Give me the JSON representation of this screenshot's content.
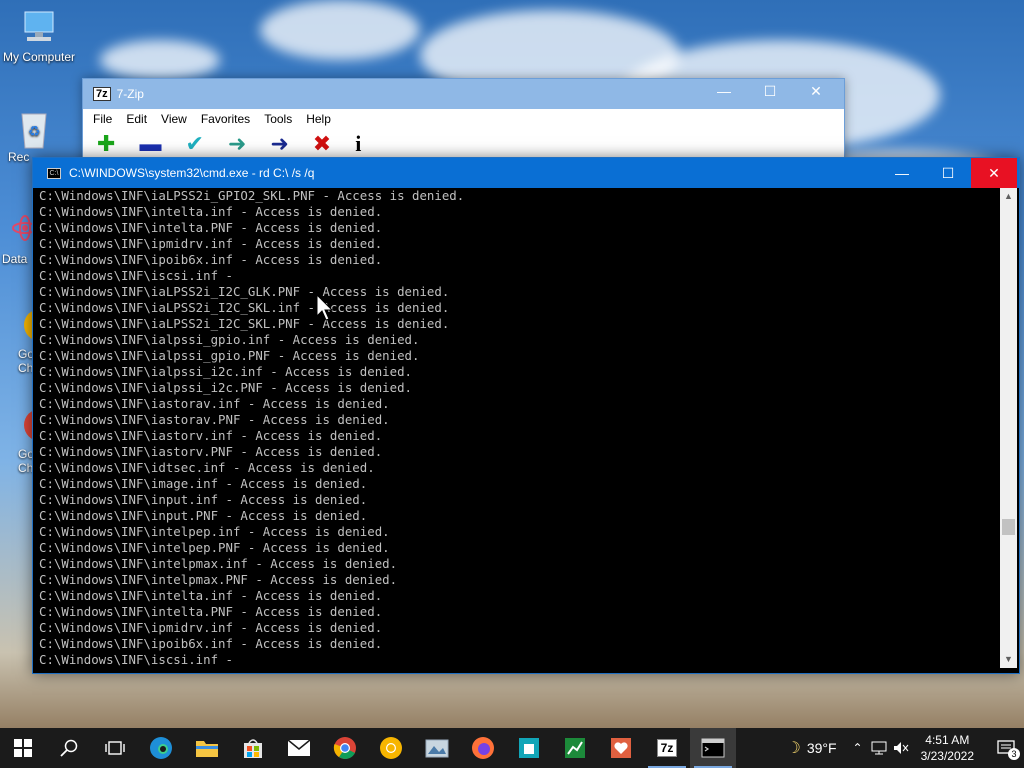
{
  "desktop": {
    "icons": [
      {
        "label": "My Computer"
      },
      {
        "label": "Rec"
      },
      {
        "label": "Data"
      },
      {
        "label": "Go Ch"
      },
      {
        "label": "Go Ch"
      }
    ]
  },
  "zip_window": {
    "title": "7-Zip",
    "logo": "7z",
    "menu": [
      "File",
      "Edit",
      "View",
      "Favorites",
      "Tools",
      "Help"
    ]
  },
  "cmd_window": {
    "title": "C:\\WINDOWS\\system32\\cmd.exe - rd  C:\\ /s /q",
    "lines": [
      "C:\\Windows\\INF\\iaLPSS2i_GPIO2_SKL.PNF - Access is denied.",
      "C:\\Windows\\INF\\intelta.inf - Access is denied.",
      "C:\\Windows\\INF\\intelta.PNF - Access is denied.",
      "C:\\Windows\\INF\\ipmidrv.inf - Access is denied.",
      "C:\\Windows\\INF\\ipoib6x.inf - Access is denied.",
      "C:\\Windows\\INF\\iscsi.inf -",
      "C:\\Windows\\INF\\iaLPSS2i_I2C_GLK.PNF - Access is denied.",
      "C:\\Windows\\INF\\iaLPSS2i_I2C_SKL.inf - Access is denied.",
      "C:\\Windows\\INF\\iaLPSS2i_I2C_SKL.PNF - Access is denied.",
      "C:\\Windows\\INF\\ialpssi_gpio.inf - Access is denied.",
      "C:\\Windows\\INF\\ialpssi_gpio.PNF - Access is denied.",
      "C:\\Windows\\INF\\ialpssi_i2c.inf - Access is denied.",
      "C:\\Windows\\INF\\ialpssi_i2c.PNF - Access is denied.",
      "C:\\Windows\\INF\\iastorav.inf - Access is denied.",
      "C:\\Windows\\INF\\iastorav.PNF - Access is denied.",
      "C:\\Windows\\INF\\iastorv.inf - Access is denied.",
      "C:\\Windows\\INF\\iastorv.PNF - Access is denied.",
      "C:\\Windows\\INF\\idtsec.inf - Access is denied.",
      "C:\\Windows\\INF\\image.inf - Access is denied.",
      "C:\\Windows\\INF\\input.inf - Access is denied.",
      "C:\\Windows\\INF\\input.PNF - Access is denied.",
      "C:\\Windows\\INF\\intelpep.inf - Access is denied.",
      "C:\\Windows\\INF\\intelpep.PNF - Access is denied.",
      "C:\\Windows\\INF\\intelpmax.inf - Access is denied.",
      "C:\\Windows\\INF\\intelpmax.PNF - Access is denied.",
      "C:\\Windows\\INF\\intelta.inf - Access is denied.",
      "C:\\Windows\\INF\\intelta.PNF - Access is denied.",
      "C:\\Windows\\INF\\ipmidrv.inf - Access is denied.",
      "C:\\Windows\\INF\\ipoib6x.inf - Access is denied.",
      "C:\\Windows\\INF\\iscsi.inf -"
    ],
    "scroll_position": 0.73
  },
  "taskbar": {
    "weather_temp": "39°F",
    "time": "4:51 AM",
    "date": "3/23/2022",
    "notification_count": "3",
    "seven_zip_label": "7z"
  },
  "colors": {
    "taskbar_bg": "#1b1b1b",
    "cmd_titlebar": "#0a6fd4",
    "close_red": "#e81123",
    "console_text": "#c0c0c0"
  }
}
